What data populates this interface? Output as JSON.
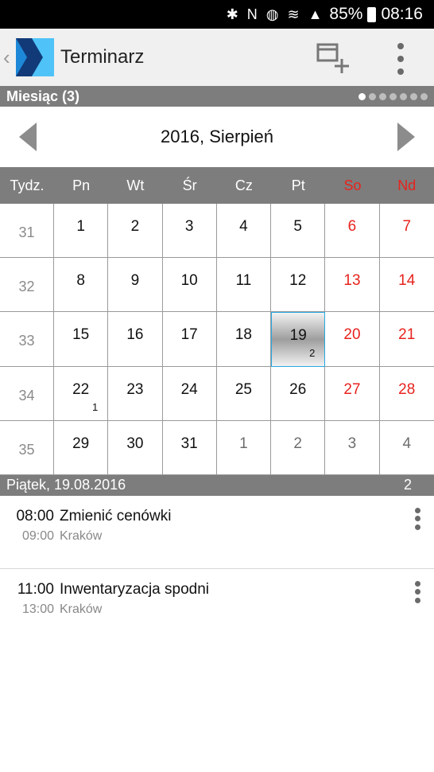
{
  "status_bar": {
    "icons": "✱ N ◍ ≋ ▲",
    "battery": "85%",
    "time": "08:16"
  },
  "app_bar": {
    "title": "Terminarz"
  },
  "section": {
    "title": "Miesiąc (3)"
  },
  "calendar": {
    "month_label": "2016, Sierpień",
    "headers": [
      "Tydz.",
      "Pn",
      "Wt",
      "Śr",
      "Cz",
      "Pt",
      "So",
      "Nd"
    ],
    "weeks": [
      {
        "num": "31",
        "days": [
          "1",
          "2",
          "3",
          "4",
          "5",
          "6",
          "7"
        ]
      },
      {
        "num": "32",
        "days": [
          "8",
          "9",
          "10",
          "11",
          "12",
          "13",
          "14"
        ]
      },
      {
        "num": "33",
        "days": [
          "15",
          "16",
          "17",
          "18",
          "19",
          "20",
          "21"
        ]
      },
      {
        "num": "34",
        "days": [
          "22",
          "23",
          "24",
          "25",
          "26",
          "27",
          "28"
        ]
      },
      {
        "num": "35",
        "days": [
          "29",
          "30",
          "31",
          "1",
          "2",
          "3",
          "4"
        ]
      }
    ],
    "counts": {
      "19": "2",
      "22": "1"
    }
  },
  "day": {
    "label": "Piątek, 19.08.2016",
    "count": "2"
  },
  "events": [
    {
      "start": "08:00",
      "end": "09:00",
      "title": "Zmienić cenówki",
      "location": "Kraków"
    },
    {
      "start": "11:00",
      "end": "13:00",
      "title": "Inwentaryzacja spodni",
      "location": "Kraków"
    }
  ],
  "colors": {
    "weekend": "#e8231d",
    "header_gray": "#7d7d7d",
    "accent": "#28a8e0"
  }
}
